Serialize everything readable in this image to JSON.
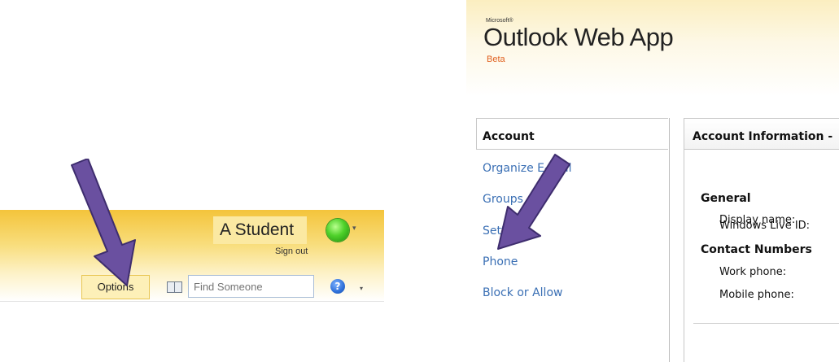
{
  "left_header": {
    "user_name": "A Student",
    "sign_out": "Sign out",
    "options_label": "Options",
    "search_placeholder": "Find Someone",
    "help_glyph": "?",
    "presence_chevron": "▾",
    "help_chevron": "▾",
    "icons": [
      "address-book-icon",
      "help-icon",
      "presence-icon"
    ],
    "colors": {
      "header_gold": "#f4c43b",
      "options_highlight": "#fdf0b8",
      "presence_green": "#4fd12a"
    }
  },
  "brand": {
    "microsoft": "Microsoft®",
    "product": "Outlook Web App",
    "edition": "Beta"
  },
  "nav": {
    "header": "Account",
    "items": [
      {
        "label": "Organize E-Mail"
      },
      {
        "label": "Groups"
      },
      {
        "label": "Settings"
      },
      {
        "label": "Phone"
      },
      {
        "label": "Block or Allow"
      }
    ]
  },
  "detail": {
    "header": "Account Information -",
    "sections": [
      {
        "title": "General",
        "fields": [
          "Display name:",
          "Windows Live ID:"
        ]
      },
      {
        "title": "Contact Numbers",
        "fields": [
          "Work phone:",
          "Mobile phone:"
        ]
      }
    ]
  },
  "annotations": {
    "arrow_color": "#6a50a0",
    "arrow_targets": [
      "options-button",
      "nav-item-settings"
    ]
  }
}
